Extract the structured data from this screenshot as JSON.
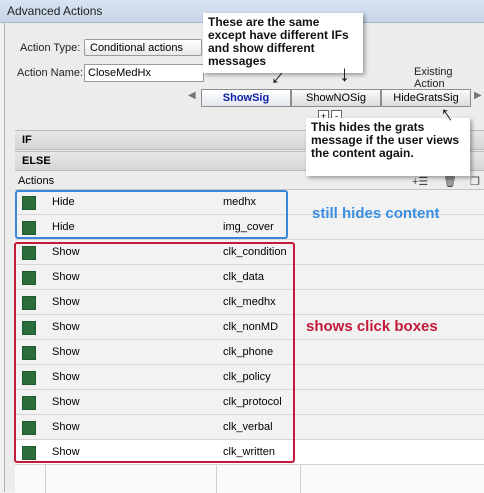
{
  "window": {
    "title": "Advanced Actions"
  },
  "form": {
    "action_type_label": "Action Type:",
    "action_type_value": "Conditional actions",
    "action_name_label": "Action Name:",
    "action_name_value": "CloseMedHx",
    "existing_label": "Existing Action"
  },
  "tabs": [
    {
      "label": "ShowSig",
      "active": true
    },
    {
      "label": "ShowNOSig",
      "active": false
    },
    {
      "label": "HideGratsSig",
      "active": false
    }
  ],
  "sections": {
    "if_label": "IF",
    "else_label": "ELSE",
    "actions_label": "Actions"
  },
  "rows": [
    {
      "action": "Hide",
      "target": "medhx"
    },
    {
      "action": "Hide",
      "target": "img_cover"
    },
    {
      "action": "Show",
      "target": "clk_condition"
    },
    {
      "action": "Show",
      "target": "clk_data"
    },
    {
      "action": "Show",
      "target": "clk_medhx"
    },
    {
      "action": "Show",
      "target": "clk_nonMD"
    },
    {
      "action": "Show",
      "target": "clk_phone"
    },
    {
      "action": "Show",
      "target": "clk_policy"
    },
    {
      "action": "Show",
      "target": "clk_protocol"
    },
    {
      "action": "Show",
      "target": "clk_verbal"
    },
    {
      "action": "Show",
      "target": "clk_written"
    }
  ],
  "annotations": {
    "top_note": "These are the same except have different IFs and show different messages",
    "right_note": "This hides the grats message if the user views the content again.",
    "hides_note": "still hides content",
    "shows_note": "shows click boxes"
  },
  "colors": {
    "accent_blue": "#3a86d9",
    "accent_red": "#c11a3a",
    "swatch_green": "#2b6e3c"
  }
}
